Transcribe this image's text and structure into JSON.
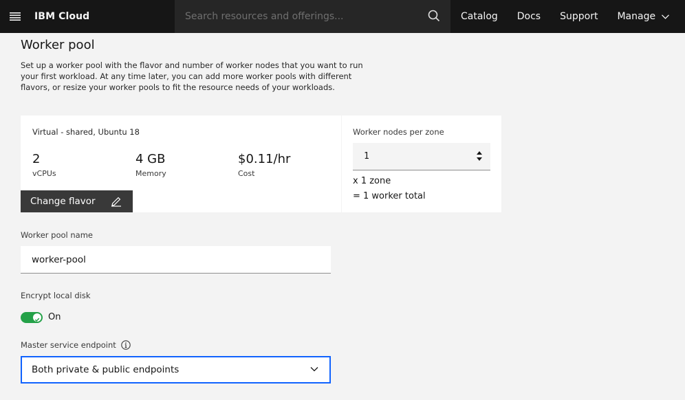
{
  "header": {
    "brand": "IBM Cloud",
    "search_placeholder": "Search resources and offerings...",
    "nav": [
      "Catalog",
      "Docs",
      "Support",
      "Manage"
    ]
  },
  "worker_pool": {
    "title": "Worker pool",
    "description": "Set up a worker pool with the flavor and number of worker nodes that you want to run your first workload. At any time later, you can add more worker pools with different flavors, or resize your worker pools to fit the resource needs of your workloads.",
    "flavor": {
      "name": "Virtual - shared, Ubuntu 18",
      "stats": [
        {
          "value": "2",
          "label": "vCPUs"
        },
        {
          "value": "4 GB",
          "label": "Memory"
        },
        {
          "value": "$0.11/hr",
          "label": "Cost"
        }
      ],
      "change_button": "Change flavor"
    },
    "nodes": {
      "label": "Worker nodes per zone",
      "value": "1",
      "zones": "x 1 zone",
      "total": "= 1 worker total"
    },
    "pool_name": {
      "label": "Worker pool name",
      "value": "worker-pool"
    },
    "encrypt": {
      "label": "Encrypt local disk",
      "state": "On"
    },
    "endpoint": {
      "label": "Master service endpoint",
      "value": "Both private & public endpoints"
    }
  },
  "colors": {
    "topbar": "#161616",
    "search_bg": "#262626",
    "toggle_on": "#24a148",
    "focus_blue": "#0f62fe",
    "button_dark": "#393939"
  },
  "icons": [
    "menu-icon",
    "search-icon",
    "chevron-down-icon",
    "pencil-icon",
    "caret-up-down-icon",
    "info-icon"
  ]
}
